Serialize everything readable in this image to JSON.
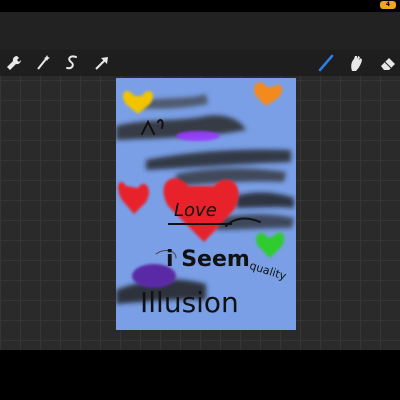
{
  "status": {
    "battery_label": "4"
  },
  "toolbar": {
    "left_tools": [
      "wrench-icon",
      "magic-wand-icon",
      "selection-icon",
      "transform-arrow-icon"
    ],
    "right_tools": [
      "brush-icon",
      "smudge-icon",
      "eraser-icon"
    ],
    "active_tool": "brush-icon",
    "accent_color": "#2f7ee6"
  },
  "canvas": {
    "background_color": "#7a9fe6",
    "texts": {
      "love": "Love",
      "i_seem": "i Seem",
      "illusion": "Illusion",
      "quality": "quality"
    }
  }
}
